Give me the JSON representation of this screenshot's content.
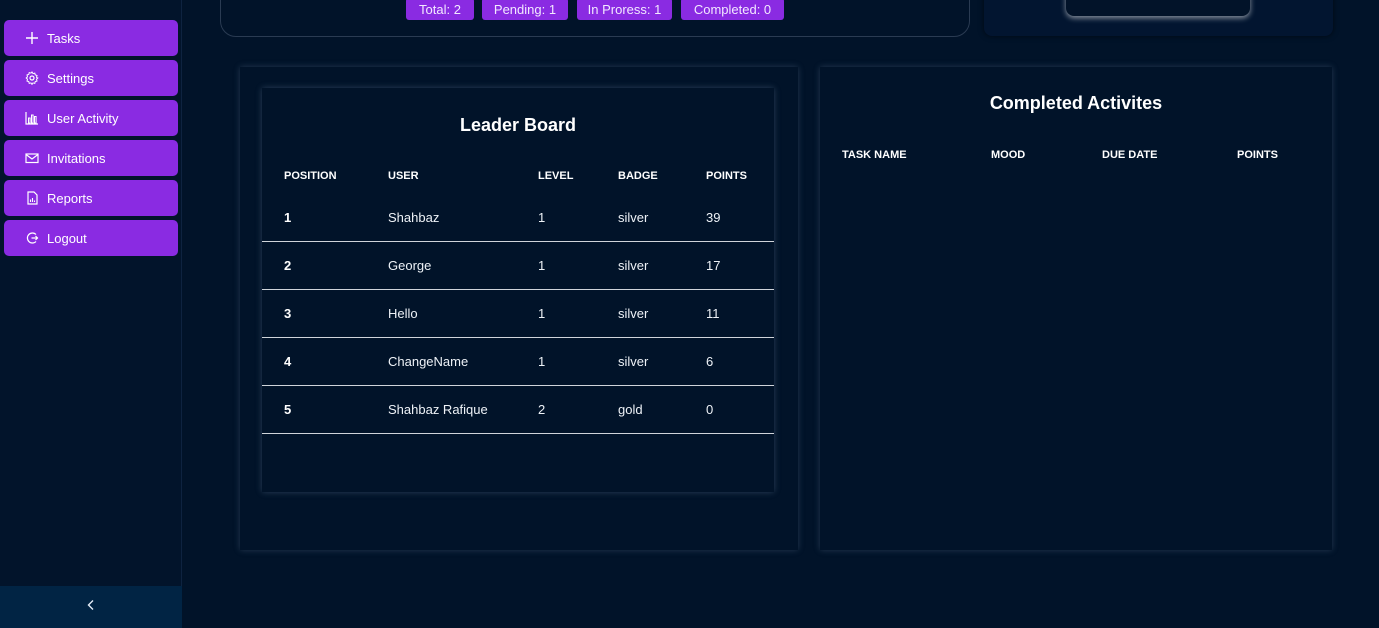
{
  "sidebar": {
    "items": [
      {
        "label": "Tasks",
        "icon": "plus-icon"
      },
      {
        "label": "Settings",
        "icon": "gear-icon"
      },
      {
        "label": "User Activity",
        "icon": "bar-chart-icon"
      },
      {
        "label": "Invitations",
        "icon": "mail-icon"
      },
      {
        "label": "Reports",
        "icon": "report-icon"
      },
      {
        "label": "Logout",
        "icon": "logout-icon"
      }
    ],
    "collapse_icon": "chevron-left-icon"
  },
  "stats": {
    "total": "Total: 2",
    "pending": "Pending: 1",
    "in_progress": "In Proress: 1",
    "completed": "Completed: 0"
  },
  "leaderboard": {
    "title": "Leader Board",
    "columns": [
      "POSITION",
      "USER",
      "LEVEL",
      "BADGE",
      "POINTS"
    ],
    "rows": [
      {
        "position": "1",
        "user": "Shahbaz",
        "level": "1",
        "badge": "silver",
        "points": "39"
      },
      {
        "position": "2",
        "user": "George",
        "level": "1",
        "badge": "silver",
        "points": "17"
      },
      {
        "position": "3",
        "user": "Hello",
        "level": "1",
        "badge": "silver",
        "points": "11"
      },
      {
        "position": "4",
        "user": "ChangeName",
        "level": "1",
        "badge": "silver",
        "points": "6"
      },
      {
        "position": "5",
        "user": "Shahbaz Rafique",
        "level": "2",
        "badge": "gold",
        "points": "0"
      }
    ]
  },
  "completed": {
    "title": "Completed Activites",
    "columns": [
      "TASK NAME",
      "MOOD",
      "DUE DATE",
      "POINTS"
    ]
  },
  "colors": {
    "background": "#011329",
    "accent": "#8a2be2",
    "sidebar_footer": "#012444"
  }
}
